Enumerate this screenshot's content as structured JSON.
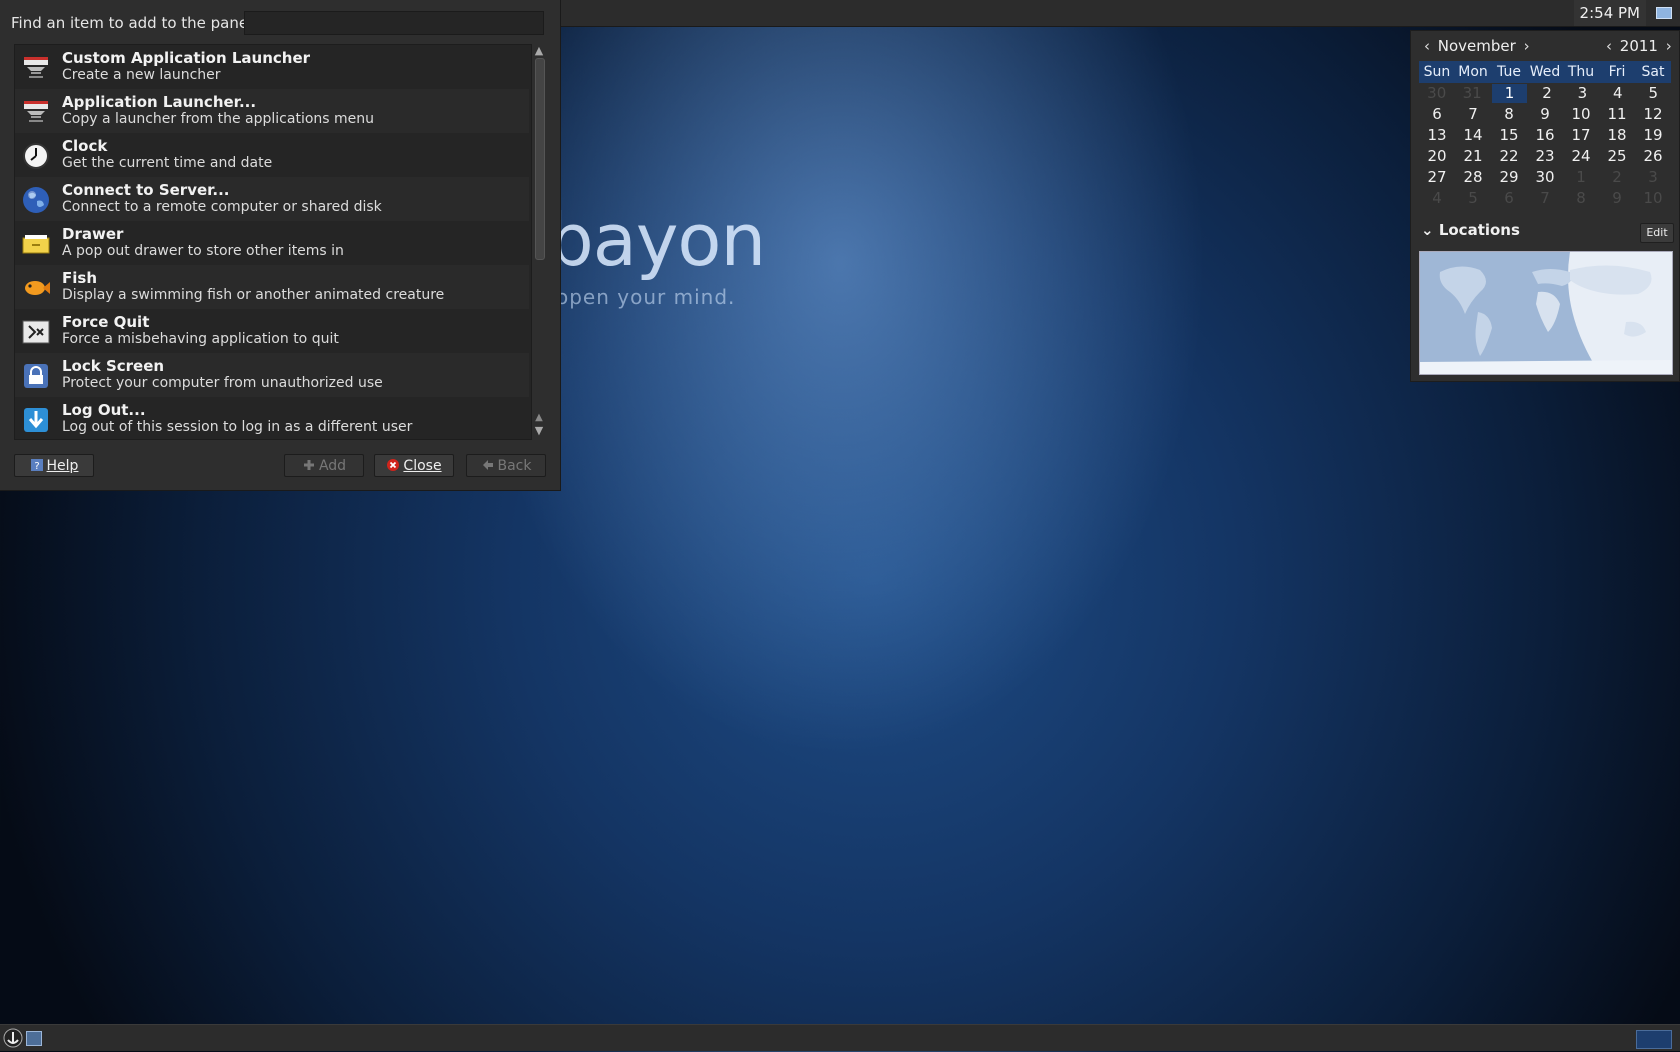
{
  "top_panel": {
    "clock": "2:54 PM"
  },
  "wallpaper": {
    "logo_text": "bayon",
    "tagline": "open your mind."
  },
  "dialog": {
    "find_label": "Find an item to add to the panel:",
    "find_value": "",
    "items": [
      {
        "title": "Custom Application Launcher",
        "desc": "Create a new launcher",
        "icon": "launcher-icon"
      },
      {
        "title": "Application Launcher...",
        "desc": "Copy a launcher from the applications menu",
        "icon": "launcher-icon"
      },
      {
        "title": "Clock",
        "desc": "Get the current time and date",
        "icon": "clock-icon"
      },
      {
        "title": "Connect to Server...",
        "desc": "Connect to a remote computer or shared disk",
        "icon": "globe-icon"
      },
      {
        "title": "Drawer",
        "desc": "A pop out drawer to store other items in",
        "icon": "drawer-icon"
      },
      {
        "title": "Fish",
        "desc": "Display a swimming fish or another animated creature",
        "icon": "fish-icon"
      },
      {
        "title": "Force Quit",
        "desc": "Force a misbehaving application to quit",
        "icon": "force-quit-icon"
      },
      {
        "title": "Lock Screen",
        "desc": "Protect your computer from unauthorized use",
        "icon": "lock-icon"
      },
      {
        "title": "Log Out...",
        "desc": "Log out of this session to log in as a different user",
        "icon": "logout-icon"
      }
    ],
    "buttons": {
      "help": "Help",
      "add": "Add",
      "close": "Close",
      "back": "Back"
    }
  },
  "calendar": {
    "month": "November",
    "year": "2011",
    "weekdays": [
      "Sun",
      "Mon",
      "Tue",
      "Wed",
      "Thu",
      "Fri",
      "Sat"
    ],
    "weeks": [
      [
        "30",
        "31",
        "1",
        "2",
        "3",
        "4",
        "5"
      ],
      [
        "6",
        "7",
        "8",
        "9",
        "10",
        "11",
        "12"
      ],
      [
        "13",
        "14",
        "15",
        "16",
        "17",
        "18",
        "19"
      ],
      [
        "20",
        "21",
        "22",
        "23",
        "24",
        "25",
        "26"
      ],
      [
        "27",
        "28",
        "29",
        "30",
        "1",
        "2",
        "3"
      ],
      [
        "4",
        "5",
        "6",
        "7",
        "8",
        "9",
        "10"
      ]
    ],
    "dim_cells": [
      "0.0",
      "0.1",
      "4.4",
      "4.5",
      "4.6",
      "5.0",
      "5.1",
      "5.2",
      "5.3",
      "5.4",
      "5.5",
      "5.6"
    ],
    "today_cell": "0.2",
    "locations_label": "Locations",
    "edit_label": "Edit"
  },
  "colors": {
    "accent": "#1d3e6e",
    "panel": "#2c2c2c",
    "dialog_bg": "#2e2e2e"
  }
}
